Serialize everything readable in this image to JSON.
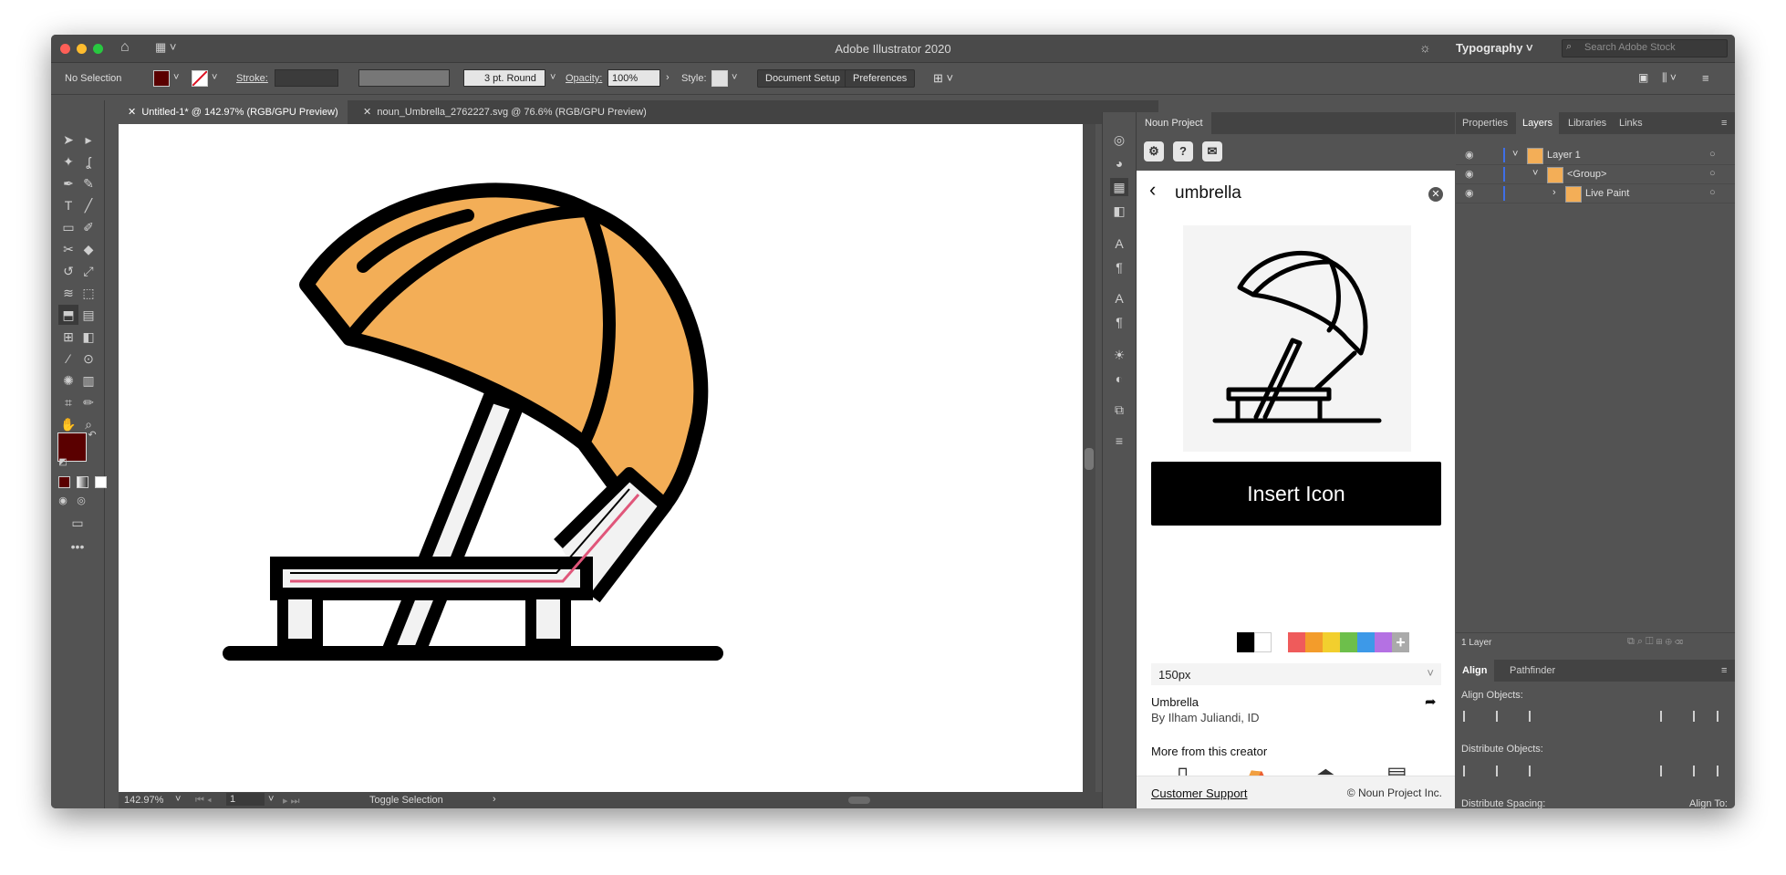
{
  "window": {
    "title": "Adobe Illustrator 2020",
    "workspace": "Typography",
    "stock_search_placeholder": "Search Adobe Stock"
  },
  "control_bar": {
    "selection": "No Selection",
    "stroke_label": "Stroke:",
    "brush": "3 pt. Round",
    "opacity_label": "Opacity:",
    "opacity": "100%",
    "style_label": "Style:",
    "document_setup": "Document Setup",
    "preferences": "Preferences",
    "fill_color": "#5a0000"
  },
  "doc_tabs": [
    {
      "label": "Untitled-1* @ 142.97% (RGB/GPU Preview)",
      "active": true
    },
    {
      "label": "noun_Umbrella_2762227.svg @ 76.6% (RGB/GPU Preview)",
      "active": false
    }
  ],
  "status": {
    "zoom": "142.97%",
    "artboard": "1",
    "action": "Toggle Selection"
  },
  "canvas_art": {
    "umbrella_color": "#f3ae57",
    "stripe_color": "#e0567a",
    "outline_color": "#000000",
    "light_fill": "#f2f2f2"
  },
  "noun_project": {
    "tab": "Noun Project",
    "search": "umbrella",
    "insert_button": "Insert Icon",
    "size": "150px",
    "icon_title": "Umbrella",
    "icon_author": "By Ilham Juliandi, ID",
    "more_heading": "More from this creator",
    "more_icons": [
      "sunscreen-icon",
      "tent-icon",
      "basket-icon",
      "radio-icon"
    ],
    "support_link": "Customer Support",
    "copyright": "© Noun Project Inc.",
    "swatches": [
      "#000000",
      "#ffffff",
      "#ef5b5b",
      "#f39c2b",
      "#f2cf2e",
      "#6dbf4b",
      "#3d99e8",
      "#b471e3"
    ]
  },
  "right_panel": {
    "tabs": [
      "Properties",
      "Layers",
      "Libraries",
      "Links"
    ],
    "active_tab": "Layers",
    "layers": [
      {
        "name": "Layer 1",
        "indent": 0
      },
      {
        "name": "<Group>",
        "indent": 1
      },
      {
        "name": "Live Paint",
        "indent": 2
      }
    ],
    "layer_count": "1 Layer",
    "align_tabs": [
      "Align",
      "Pathfinder"
    ],
    "align_objects": "Align Objects:",
    "distribute_objects": "Distribute Objects:",
    "distribute_spacing": "Distribute Spacing:",
    "align_to": "Align To:"
  }
}
